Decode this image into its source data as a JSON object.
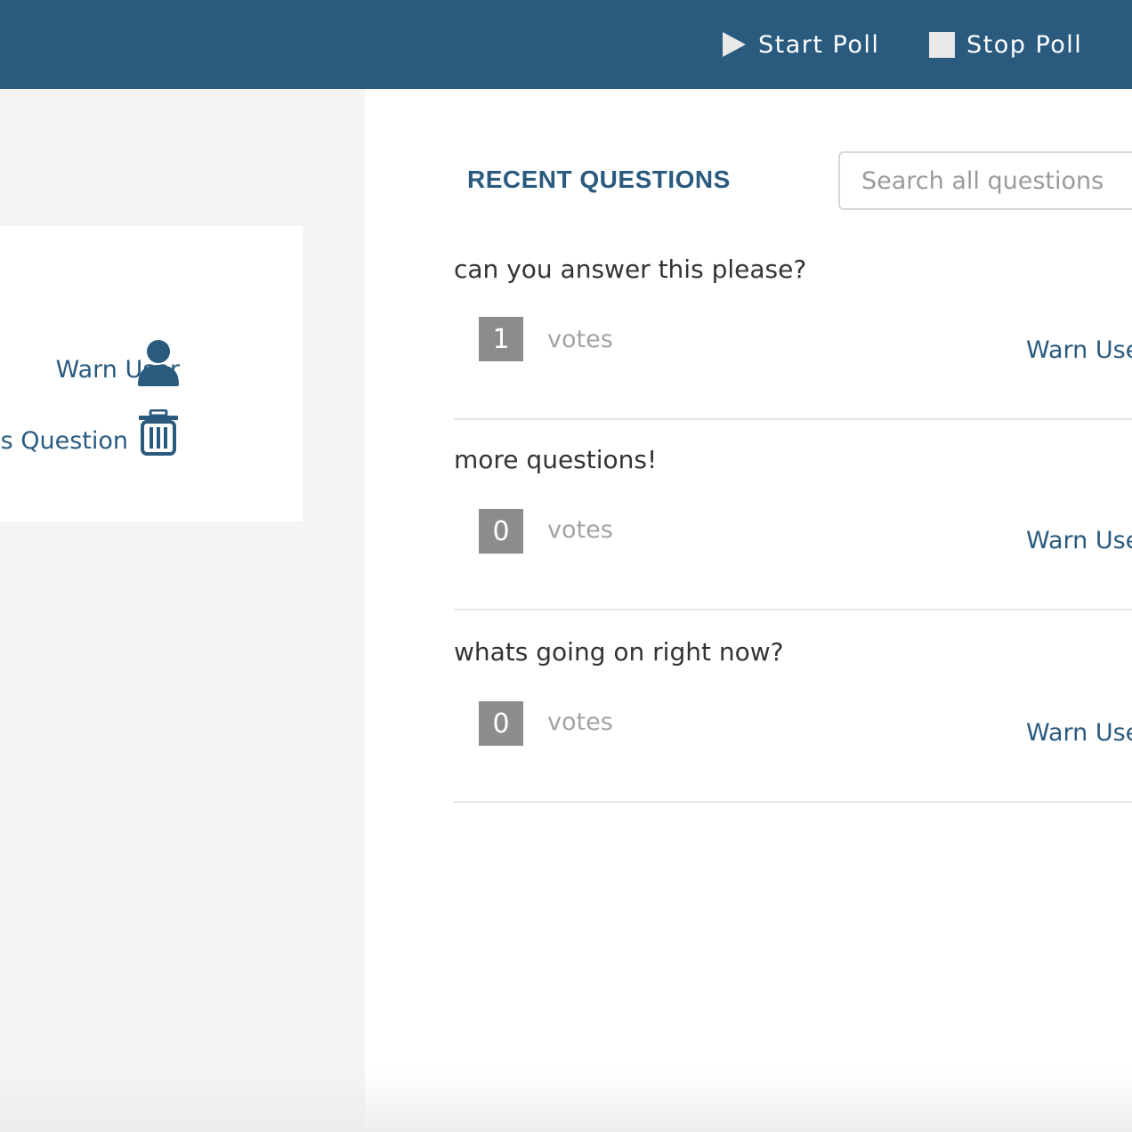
{
  "toolbar": {
    "start_poll_label": "Start Poll",
    "stop_poll_label": "Stop Poll"
  },
  "detail_panel": {
    "warn_user_label": "Warn User",
    "dismiss_question_label": "ss Question"
  },
  "main": {
    "section_title": "RECENT QUESTIONS",
    "search_placeholder": "Search all questions",
    "questions": [
      {
        "text": "can you answer this please?",
        "votes": "1",
        "votes_label": "votes",
        "warn_label": "Warn Use"
      },
      {
        "text": "more questions!",
        "votes": "0",
        "votes_label": "votes",
        "warn_label": "Warn Use"
      },
      {
        "text": "whats going on right now?",
        "votes": "0",
        "votes_label": "votes",
        "warn_label": "Warn Use"
      }
    ]
  },
  "colors": {
    "brand": "#2a5b7f",
    "vote_box": "#8c8c8c",
    "panel_bg": "#f4f4f4"
  }
}
